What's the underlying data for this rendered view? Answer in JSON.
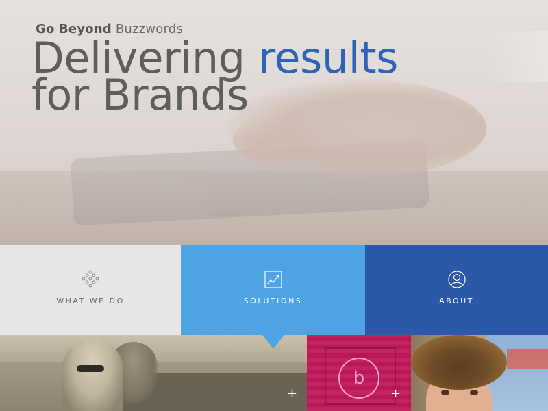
{
  "hero": {
    "tagline_bold": "Go Beyond",
    "tagline_light": "Buzzwords",
    "headline_part1": "Delivering",
    "headline_accent": "results",
    "headline_line2": "for Brands"
  },
  "nav": {
    "tiles": [
      {
        "label": "WHAT WE DO",
        "icon": "diamond-dots-icon"
      },
      {
        "label": "SOLUTIONS",
        "icon": "chart-icon"
      },
      {
        "label": "ABOUT",
        "icon": "person-icon"
      }
    ]
  },
  "panels": {
    "plus_symbol": "+"
  },
  "colors": {
    "accent": "#2f63b7",
    "solutions_bg": "#4da3e4",
    "about_bg": "#2b58a7",
    "magenta_panel": "#c21a5b"
  }
}
